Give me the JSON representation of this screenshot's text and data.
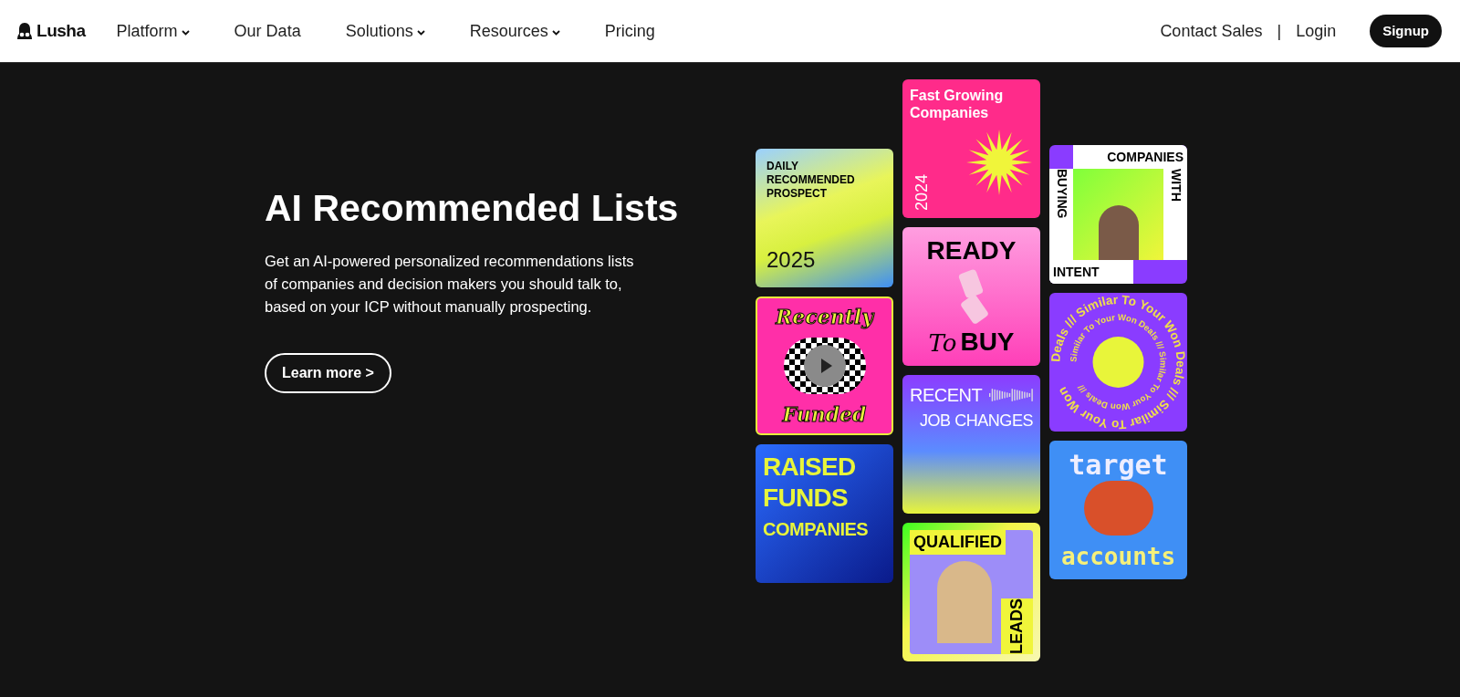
{
  "nav": {
    "logo": "Lusha",
    "menu": [
      {
        "label": "Platform",
        "dropdown": true
      },
      {
        "label": "Our Data",
        "dropdown": false
      },
      {
        "label": "Solutions",
        "dropdown": true
      },
      {
        "label": "Resources",
        "dropdown": true
      },
      {
        "label": "Pricing",
        "dropdown": false
      }
    ],
    "contact": "Contact Sales",
    "separator": "|",
    "login": "Login",
    "signup": "Signup"
  },
  "hero": {
    "title": "AI Recommended Lists",
    "body": "Get an AI-powered personalized recommendations lists of companies and decision makers you should talk to, based on your ICP without manually prospecting.",
    "button": "Learn more >"
  },
  "tiles": [
    [
      {
        "kind": "prospect",
        "lines": [
          "DAILY RECOMMENDED PROSPECT",
          "2025"
        ]
      },
      {
        "kind": "funded",
        "lines": [
          "Recently",
          "Funded"
        ]
      },
      {
        "kind": "raised",
        "lines": [
          "RAISED",
          "FUNDS",
          "COMPANIES"
        ]
      }
    ],
    [
      {
        "kind": "fast",
        "lines": [
          "Fast Growing Companies",
          "2024"
        ]
      },
      {
        "kind": "ready",
        "lines": [
          "READY",
          "To",
          "BUY"
        ]
      },
      {
        "kind": "jobs",
        "lines": [
          "RECENT",
          "JOB CHANGES"
        ]
      },
      {
        "kind": "qualified",
        "lines": [
          "QUALIFIED",
          "LEADS"
        ]
      }
    ],
    [
      {
        "kind": "intent",
        "lines": [
          "COMPANIES",
          "WITH",
          "BUYING",
          "INTENT"
        ]
      },
      {
        "kind": "won",
        "lines": [
          "Deals /// Similar To Your Won Deals /// Similar To Your Won",
          "Similar To Your Won Deals /// Similar To Your Won Deals ///"
        ]
      },
      {
        "kind": "target",
        "lines": [
          "target",
          "accounts"
        ]
      }
    ]
  ]
}
